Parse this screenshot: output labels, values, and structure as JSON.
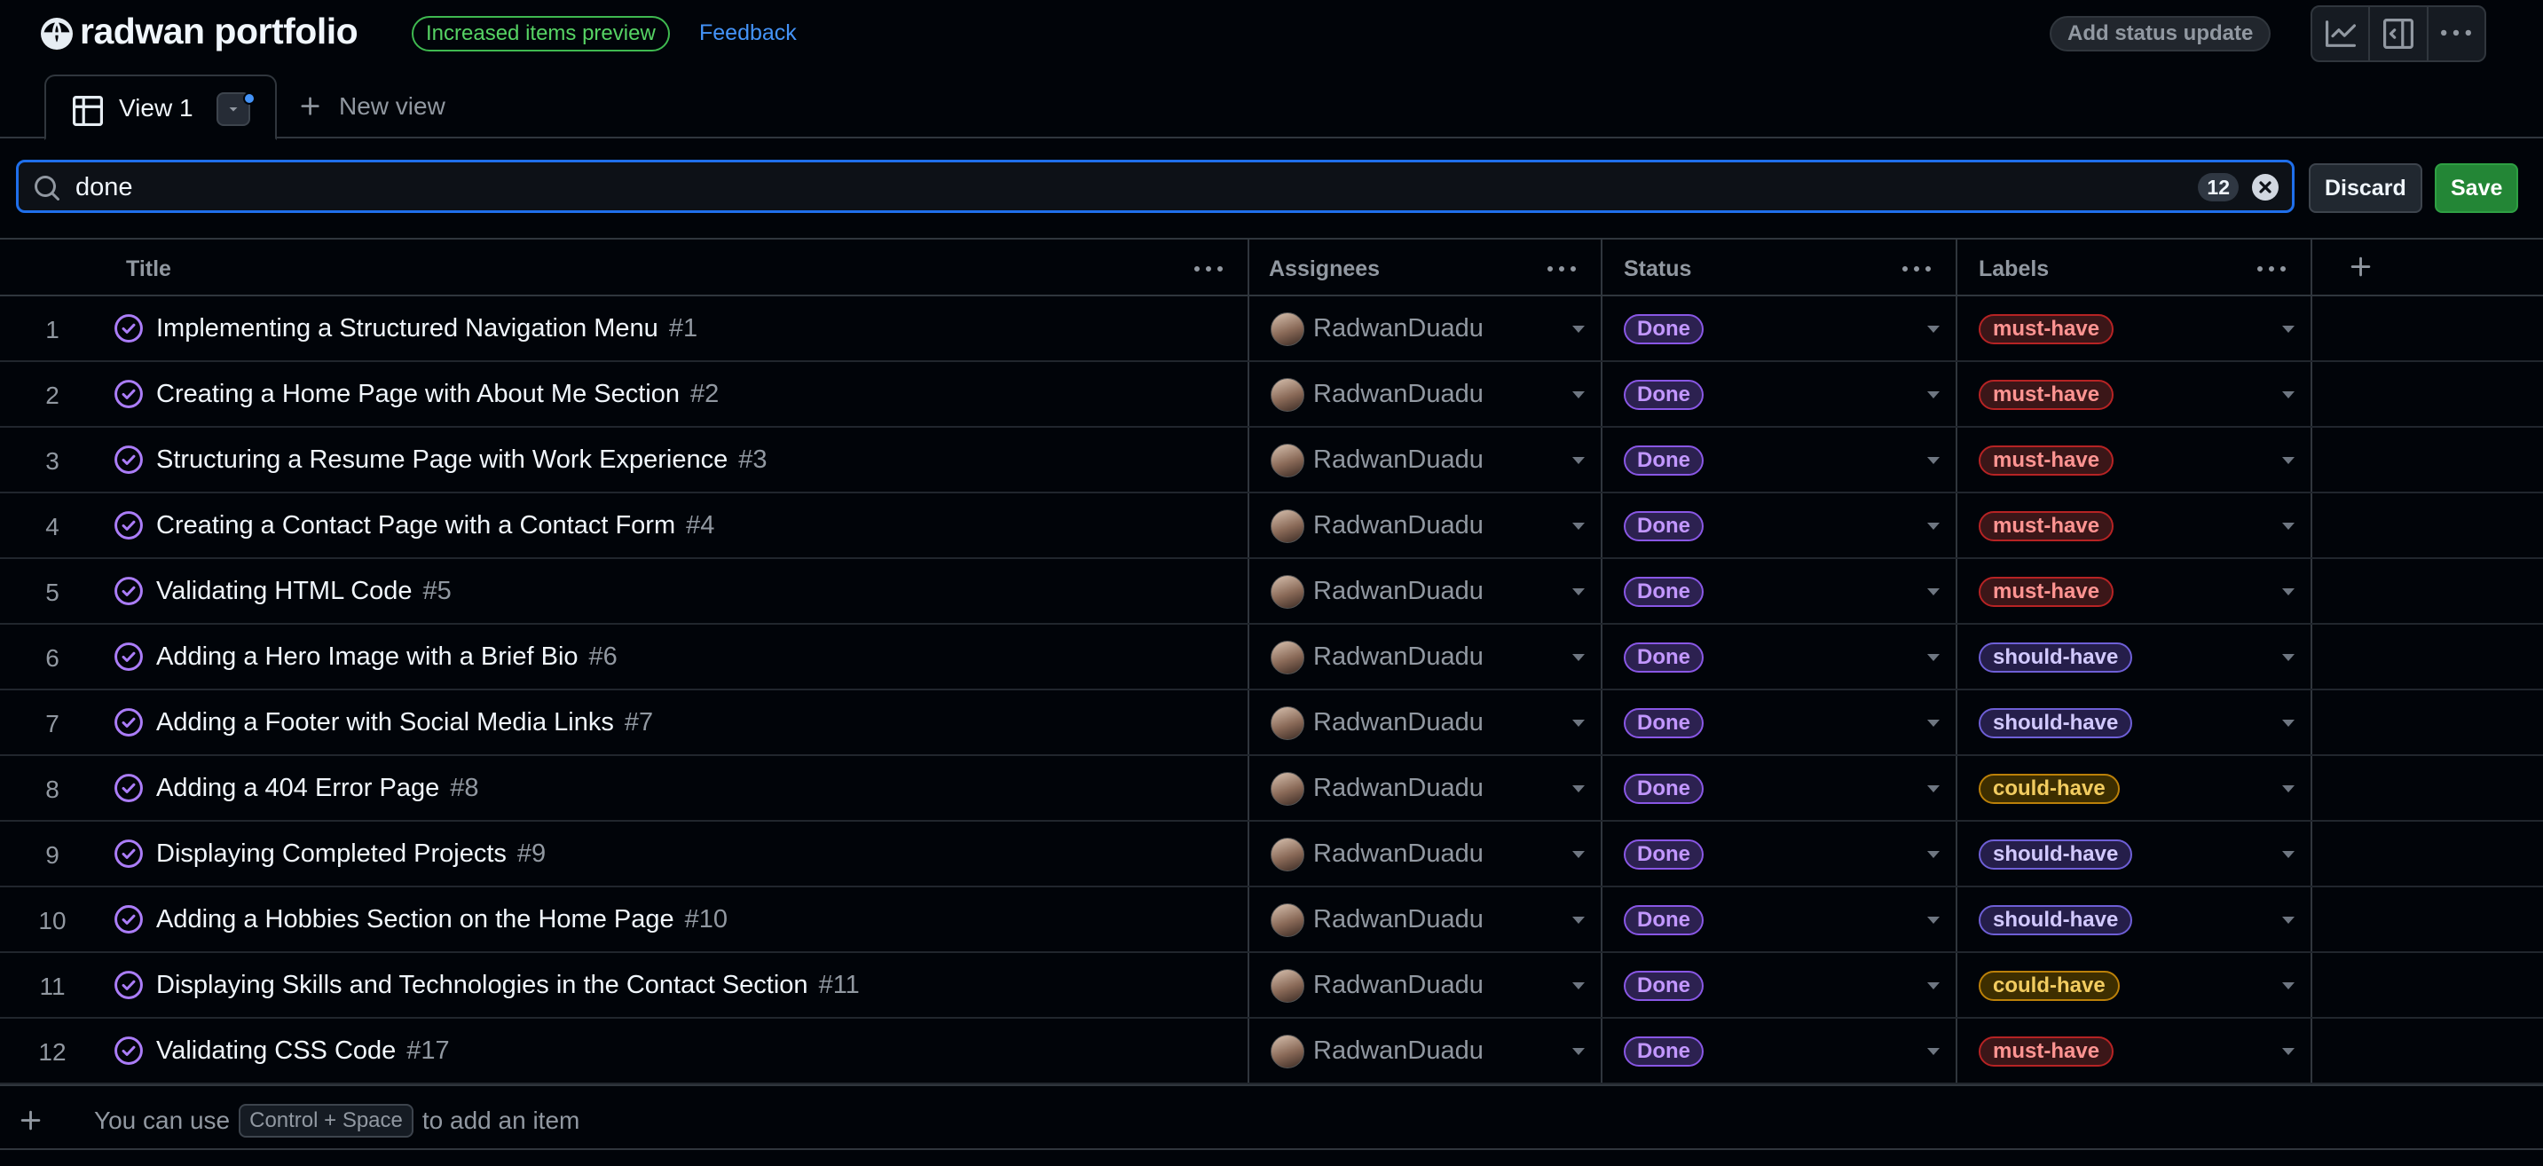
{
  "header": {
    "title": "radwan portfolio",
    "preview_badge": "Increased items preview",
    "feedback_link": "Feedback",
    "status_button": "Add status update"
  },
  "tabs": {
    "active_label": "View 1",
    "new_view_label": "New view"
  },
  "filter": {
    "query": "done",
    "result_count": "12",
    "discard_label": "Discard",
    "save_label": "Save"
  },
  "columns": [
    "Title",
    "Assignees",
    "Status",
    "Labels"
  ],
  "rows": [
    {
      "n": "1",
      "title": "Implementing a Structured Navigation Menu",
      "issue": "#1",
      "assignee": "RadwanDuadu",
      "status": "Done",
      "label": "must-have"
    },
    {
      "n": "2",
      "title": "Creating a Home Page with About Me Section",
      "issue": "#2",
      "assignee": "RadwanDuadu",
      "status": "Done",
      "label": "must-have"
    },
    {
      "n": "3",
      "title": "Structuring a Resume Page with Work Experience",
      "issue": "#3",
      "assignee": "RadwanDuadu",
      "status": "Done",
      "label": "must-have"
    },
    {
      "n": "4",
      "title": "Creating a Contact Page with a Contact Form",
      "issue": "#4",
      "assignee": "RadwanDuadu",
      "status": "Done",
      "label": "must-have"
    },
    {
      "n": "5",
      "title": "Validating HTML Code",
      "issue": "#5",
      "assignee": "RadwanDuadu",
      "status": "Done",
      "label": "must-have"
    },
    {
      "n": "6",
      "title": "Adding a Hero Image with a Brief Bio",
      "issue": "#6",
      "assignee": "RadwanDuadu",
      "status": "Done",
      "label": "should-have"
    },
    {
      "n": "7",
      "title": "Adding a Footer with Social Media Links",
      "issue": "#7",
      "assignee": "RadwanDuadu",
      "status": "Done",
      "label": "should-have"
    },
    {
      "n": "8",
      "title": "Adding a 404 Error Page",
      "issue": "#8",
      "assignee": "RadwanDuadu",
      "status": "Done",
      "label": "could-have"
    },
    {
      "n": "9",
      "title": "Displaying Completed Projects",
      "issue": "#9",
      "assignee": "RadwanDuadu",
      "status": "Done",
      "label": "should-have"
    },
    {
      "n": "10",
      "title": "Adding a Hobbies Section on the Home Page",
      "issue": "#10",
      "assignee": "RadwanDuadu",
      "status": "Done",
      "label": "should-have"
    },
    {
      "n": "11",
      "title": "Displaying Skills and Technologies in the Contact Section",
      "issue": "#11",
      "assignee": "RadwanDuadu",
      "status": "Done",
      "label": "could-have"
    },
    {
      "n": "12",
      "title": "Validating CSS Code",
      "issue": "#17",
      "assignee": "RadwanDuadu",
      "status": "Done",
      "label": "must-have"
    }
  ],
  "footer": {
    "prefix": "You can use",
    "shortcut": "Control + Space",
    "suffix": "to add an item"
  },
  "colors": {
    "background": "#010409",
    "accent_blue": "#1f6feb",
    "save_green": "#238636",
    "done_purple": "#8957e5",
    "must_have_red": "#b62324",
    "should_have_violet": "#6e5fd6",
    "could_have_yellow": "#bb8009"
  },
  "icons": [
    "globe-icon",
    "insights-icon",
    "side-panel-icon",
    "kebab-icon",
    "table-view-icon",
    "chevron-down-icon",
    "plus-icon",
    "search-icon",
    "clear-icon",
    "issue-closed-icon"
  ]
}
